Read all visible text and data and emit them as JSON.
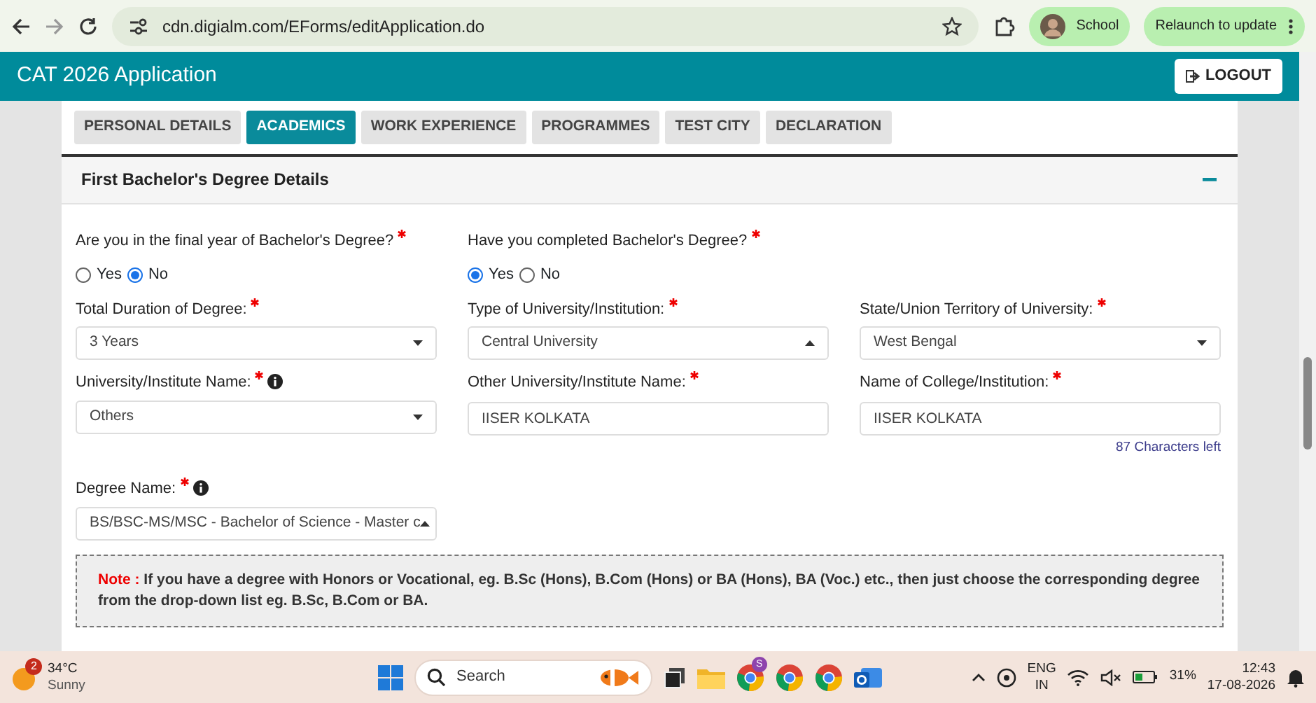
{
  "browser": {
    "url": "cdn.digialm.com/EForms/editApplication.do",
    "profile": "School",
    "update_button": "Relaunch to update"
  },
  "header": {
    "title": "CAT 2026 Application",
    "logout": "LOGOUT"
  },
  "tabs": [
    {
      "label": "PERSONAL DETAILS",
      "selected": false
    },
    {
      "label": "ACADEMICS",
      "selected": true
    },
    {
      "label": "WORK EXPERIENCE",
      "selected": false
    },
    {
      "label": "PROGRAMMES",
      "selected": false
    },
    {
      "label": "TEST CITY",
      "selected": false
    },
    {
      "label": "DECLARATION",
      "selected": false
    }
  ],
  "section": {
    "title": "First Bachelor's Degree Details",
    "expanded": true
  },
  "rows": [
    [
      {
        "kind": "radio",
        "label": "Are you in the final year of Bachelor's Degree?",
        "required": true,
        "info": false,
        "options": [
          {
            "label": "Yes",
            "selected": false
          },
          {
            "label": "No",
            "selected": true
          }
        ]
      },
      {
        "kind": "radio",
        "label": "Have you completed Bachelor's Degree?",
        "required": true,
        "info": false,
        "options": [
          {
            "label": "Yes",
            "selected": true
          },
          {
            "label": "No",
            "selected": false
          }
        ]
      }
    ],
    [
      {
        "kind": "select",
        "label": "Total Duration of Degree:",
        "required": true,
        "info": false,
        "value": "3 Years",
        "open": false
      },
      {
        "kind": "select",
        "label": "Type of University/Institution:",
        "required": true,
        "info": false,
        "value": "Central University",
        "open": true
      },
      {
        "kind": "select",
        "label": "State/Union Territory of University:",
        "required": true,
        "info": false,
        "value": "West Bengal",
        "open": false
      }
    ],
    [
      {
        "kind": "select",
        "label": "University/Institute Name:",
        "required": true,
        "info": true,
        "value": "Others",
        "open": false
      },
      {
        "kind": "text",
        "label": "Other University/Institute Name:",
        "required": true,
        "info": false,
        "value": "IISER KOLKATA"
      },
      {
        "kind": "text",
        "label": "Name of College/Institution:",
        "required": true,
        "info": false,
        "value": "IISER KOLKATA",
        "hint": "87 Characters left"
      }
    ],
    [
      {
        "kind": "select",
        "label": "Degree Name:",
        "required": true,
        "info": true,
        "value": "BS/BSC-MS/MSC - Bachelor of Science - Master c",
        "open": true
      }
    ]
  ],
  "note": {
    "label": "Note :",
    "text": "If you have a degree with Honors or Vocational, eg. B.Sc (Hons), B.Com (Hons) or BA (Hons), BA (Voc.) etc., then just choose the corresponding degree from the drop-down list eg. B.Sc, B.Com or BA."
  },
  "taskbar": {
    "weather_badge": "2",
    "temperature": "34°C",
    "condition": "Sunny",
    "search_placeholder": "Search",
    "app_badge": "S",
    "language": "ENG",
    "region": "IN",
    "battery": "31%",
    "time": "12:43",
    "date": "17-08-2026"
  }
}
